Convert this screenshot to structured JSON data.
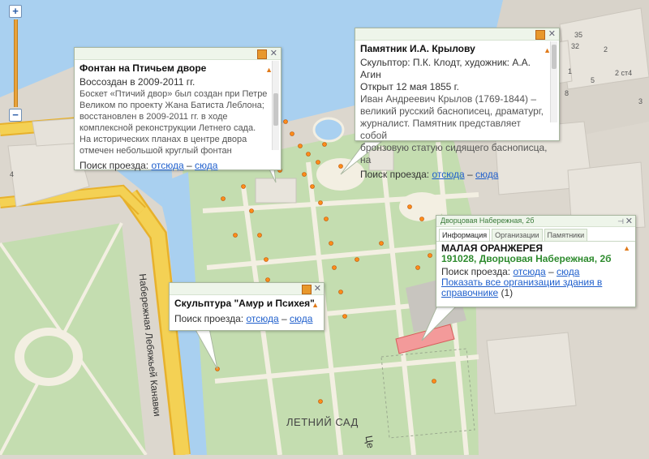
{
  "map": {
    "labels": {
      "embankment": "Набережная Лебяжьей Канавки",
      "garden": "ЛЕТНИЙ САД",
      "partial_street": "Це",
      "house_4": "4",
      "house_35": "35",
      "house_32": "32",
      "house_2": "2",
      "house_2st4": "2 ст4",
      "house_1": "1",
      "house_5": "5",
      "house_8": "8",
      "house_3": "3"
    },
    "colors": {
      "water": "#a9d0f0",
      "land": "#dcd7ce",
      "park": "#c4ddb0",
      "path": "#f3efe2",
      "road": "#f4d154",
      "road_edge": "#e7b12c",
      "highlight": "#f39a9a"
    }
  },
  "zoom": {
    "plus": "+",
    "minus": "−"
  },
  "popups": {
    "fountain": {
      "title": "Фонтан на Птичьем дворе",
      "lines": [
        "Воссоздан в 2009-2011 гг.",
        "Боскет «Птичий двор» был создан при Петре",
        "Великом по проекту Жана Батиста Леблона;",
        "восстановлен в 2009-2011 гг. в ходе",
        "комплексной реконструкции Летнего сада.",
        "На исторических планах в центре двора",
        "отмечен небольшой круглый фонтан"
      ],
      "route_label": "Поиск проезда:",
      "from": "отсюда",
      "dash": "–",
      "to": "сюда"
    },
    "krylov": {
      "title": "Памятник И.А. Крылову",
      "lines": [
        "Скульптор: П.К. Клодт, художник: А.А. Агин",
        "Открыт 12 мая 1855 г."
      ],
      "desc_lines": [
        "Иван Андреевич Крылов (1769-1844) –",
        "великий русский баснописец, драматург,",
        "журналист. Памятник представляет собой",
        "бронзовую статую сидящего баснописца, на"
      ],
      "route_label": "Поиск проезда:",
      "from": "отсюда",
      "dash": "–",
      "to": "сюда"
    },
    "amur": {
      "title": "Скульптура \"Амур и Психея\"",
      "route_label": "Поиск проезда:",
      "from": "отсюда",
      "dash": "–",
      "to": "сюда"
    },
    "orangery": {
      "header": "Дворцовая Набережная, 2б",
      "tabs": [
        "Информация",
        "Организации",
        "Памятники"
      ],
      "title": "МАЛАЯ ОРАНЖЕРЕЯ",
      "address": "191028, Дворцовая Набережная, 2б",
      "route_label": "Поиск проезда:",
      "from": "отсюда",
      "dash": "–",
      "to": "сюда",
      "show_all_1": "Показать все организации здания в",
      "show_all_2": "справочнике",
      "count": "(1)"
    }
  }
}
